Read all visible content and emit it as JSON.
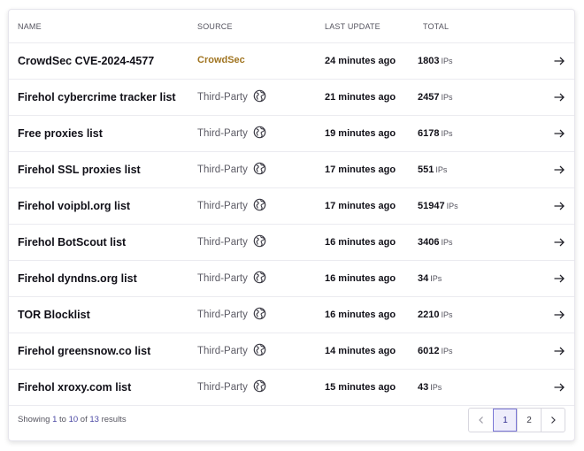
{
  "columns": {
    "name": "NAME",
    "source": "SOURCE",
    "last_update": "LAST UPDATE",
    "total": "TOTAL"
  },
  "rows": [
    {
      "name": "CrowdSec CVE-2024-4577",
      "source": "CrowdSec",
      "source_icon": "",
      "update": "24 minutes ago",
      "total": "1803",
      "unit": "IPs"
    },
    {
      "name": "Firehol cybercrime tracker list",
      "source": "Third-Party",
      "source_icon": "globe-icon",
      "update": "21 minutes ago",
      "total": "2457",
      "unit": "IPs"
    },
    {
      "name": "Free proxies list",
      "source": "Third-Party",
      "source_icon": "globe-icon",
      "update": "19 minutes ago",
      "total": "6178",
      "unit": "IPs"
    },
    {
      "name": "Firehol SSL proxies list",
      "source": "Third-Party",
      "source_icon": "globe-icon",
      "update": "17 minutes ago",
      "total": "551",
      "unit": "IPs"
    },
    {
      "name": "Firehol voipbl.org list",
      "source": "Third-Party",
      "source_icon": "globe-icon",
      "update": "17 minutes ago",
      "total": "51947",
      "unit": "IPs"
    },
    {
      "name": "Firehol BotScout list",
      "source": "Third-Party",
      "source_icon": "globe-icon",
      "update": "16 minutes ago",
      "total": "3406",
      "unit": "IPs"
    },
    {
      "name": "Firehol dyndns.org list",
      "source": "Third-Party",
      "source_icon": "globe-icon",
      "update": "16 minutes ago",
      "total": "34",
      "unit": "IPs"
    },
    {
      "name": "TOR Blocklist",
      "source": "Third-Party",
      "source_icon": "globe-icon",
      "update": "16 minutes ago",
      "total": "2210",
      "unit": "IPs"
    },
    {
      "name": "Firehol greensnow.co list",
      "source": "Third-Party",
      "source_icon": "globe-icon",
      "update": "14 minutes ago",
      "total": "6012",
      "unit": "IPs"
    },
    {
      "name": "Firehol xroxy.com list",
      "source": "Third-Party",
      "source_icon": "globe-icon",
      "update": "15 minutes ago",
      "total": "43",
      "unit": "IPs"
    }
  ],
  "footer": {
    "showing_prefix": "Showing ",
    "from": "1",
    "to_word": " to ",
    "to": "10",
    "of_word": " of ",
    "total": "13",
    "results_word": " results"
  },
  "pagination": {
    "prev_icon": "chevron-left-icon",
    "pages": [
      "1",
      "2"
    ],
    "current": "1",
    "next_icon": "chevron-right-icon"
  },
  "colors": {
    "crowdsec": "#a07420",
    "accent": "#4a47a3"
  }
}
